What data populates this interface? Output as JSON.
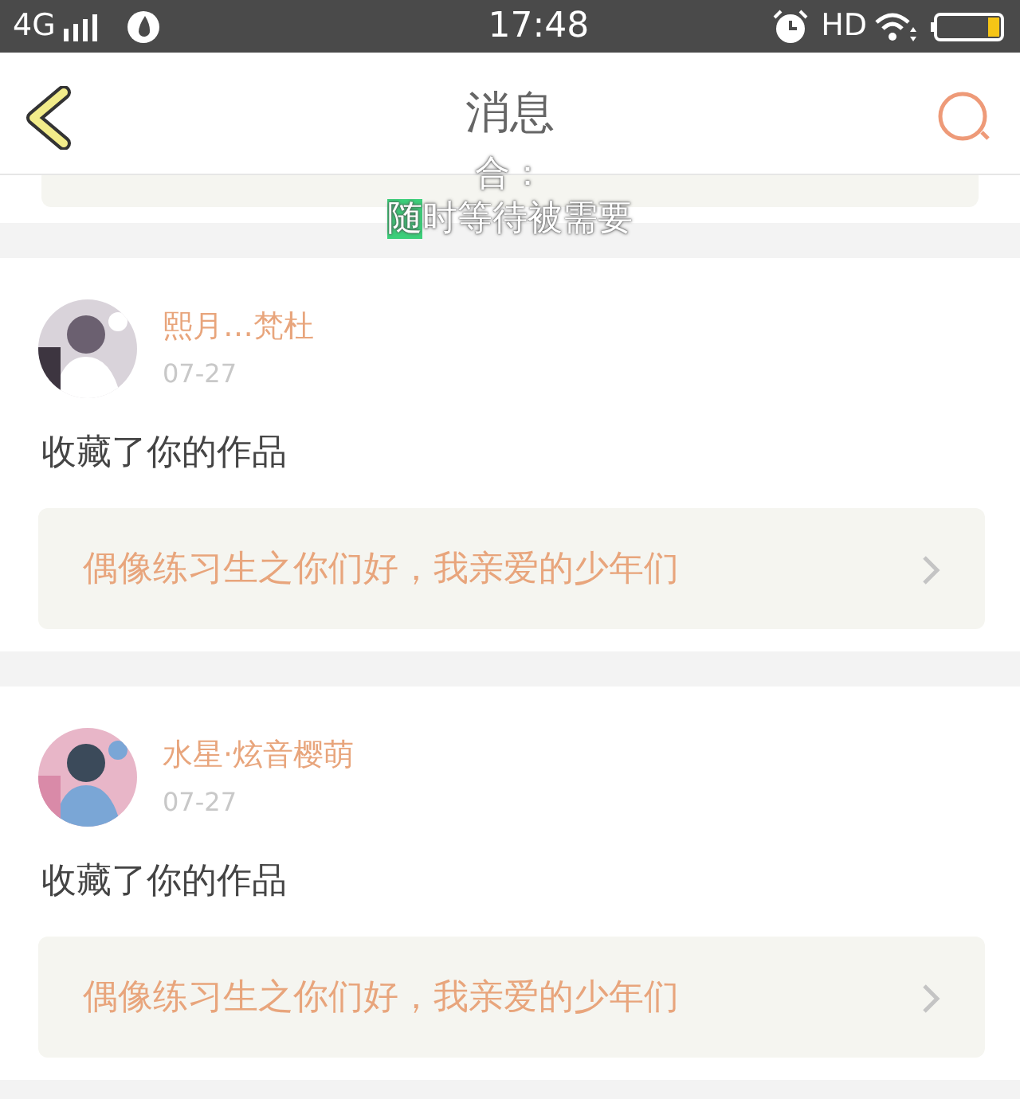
{
  "status_bar": {
    "network": "4G",
    "time": "17:48",
    "hd": "HD"
  },
  "header": {
    "title": "消息"
  },
  "caption": [
    {
      "segments": [
        {
          "text": "合：",
          "highlighted": false
        }
      ]
    },
    {
      "segments": [
        {
          "text": "随",
          "highlighted": true
        },
        {
          "text": "时等待被需要",
          "highlighted": false
        }
      ]
    }
  ],
  "notifications": [
    {
      "user": "熙月…梵杜",
      "date": "07-27",
      "action": "收藏了你的作品",
      "work": "偶像练习生之你们好，我亲爱的少年们"
    },
    {
      "user": "水星·炫音樱萌",
      "date": "07-27",
      "action": "收藏了你的作品",
      "work": "偶像练习生之你们好，我亲爱的少年们"
    }
  ]
}
